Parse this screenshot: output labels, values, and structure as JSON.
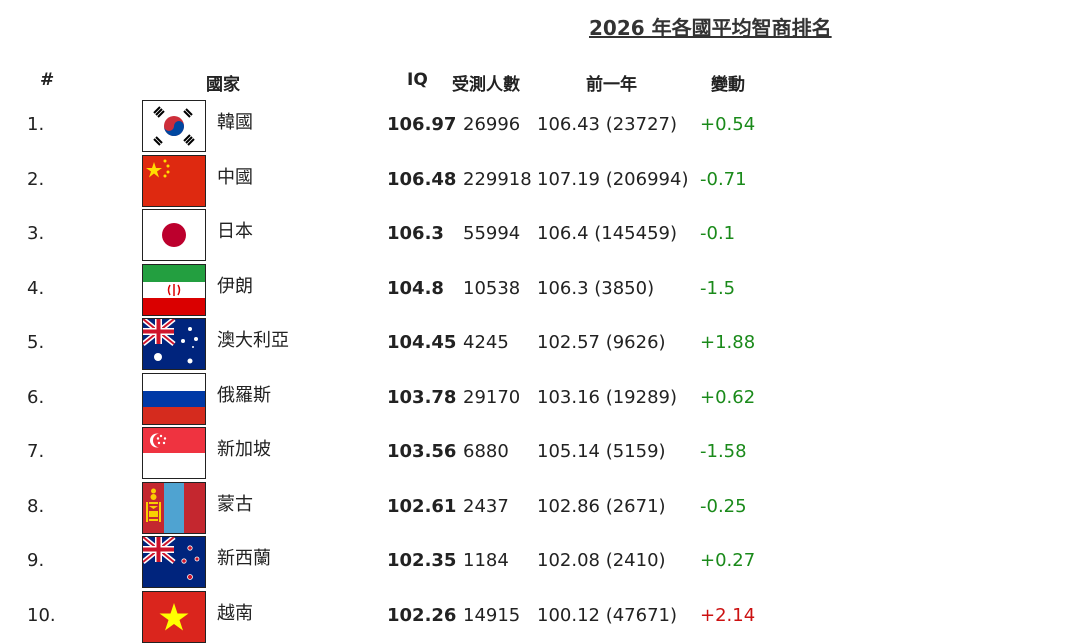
{
  "title": "2026 年各國平均智商排名",
  "headers": {
    "rank": "#",
    "country": "國家",
    "iq": "IQ",
    "tested": "受測人數",
    "previous": "前一年",
    "change": "變動"
  },
  "rows": [
    {
      "rank": "1.",
      "flag": "south-korea-flag",
      "country": "韓國",
      "iq": "106.97",
      "tested": "26996",
      "previous": "106.43 (23727)",
      "change": "+0.54",
      "change_color": "#1a8a1a"
    },
    {
      "rank": "2.",
      "flag": "china-flag",
      "country": "中國",
      "iq": "106.48",
      "tested": "229918",
      "previous": "107.19 (206994)",
      "change": "-0.71",
      "change_color": "#1a8a1a"
    },
    {
      "rank": "3.",
      "flag": "japan-flag",
      "country": "日本",
      "iq": "106.3",
      "tested": "55994",
      "previous": "106.4 (145459)",
      "change": "-0.1",
      "change_color": "#1a8a1a"
    },
    {
      "rank": "4.",
      "flag": "iran-flag",
      "country": "伊朗",
      "iq": "104.8",
      "tested": "10538",
      "previous": "106.3 (3850)",
      "change": "-1.5",
      "change_color": "#1a8a1a"
    },
    {
      "rank": "5.",
      "flag": "australia-flag",
      "country": "澳大利亞",
      "iq": "104.45",
      "tested": "4245",
      "previous": "102.57 (9626)",
      "change": "+1.88",
      "change_color": "#1a8a1a"
    },
    {
      "rank": "6.",
      "flag": "russia-flag",
      "country": "俄羅斯",
      "iq": "103.78",
      "tested": "29170",
      "previous": "103.16 (19289)",
      "change": "+0.62",
      "change_color": "#1a8a1a"
    },
    {
      "rank": "7.",
      "flag": "singapore-flag",
      "country": "新加坡",
      "iq": "103.56",
      "tested": "6880",
      "previous": "105.14 (5159)",
      "change": "-1.58",
      "change_color": "#1a8a1a"
    },
    {
      "rank": "8.",
      "flag": "mongolia-flag",
      "country": "蒙古",
      "iq": "102.61",
      "tested": "2437",
      "previous": "102.86 (2671)",
      "change": "-0.25",
      "change_color": "#1a8a1a"
    },
    {
      "rank": "9.",
      "flag": "new-zealand-flag",
      "country": "新西蘭",
      "iq": "102.35",
      "tested": "1184",
      "previous": "102.08 (2410)",
      "change": "+0.27",
      "change_color": "#1a8a1a"
    },
    {
      "rank": "10.",
      "flag": "vietnam-flag",
      "country": "越南",
      "iq": "102.26",
      "tested": "14915",
      "previous": "100.12 (47671)",
      "change": "+2.14",
      "change_color": "#cc1111"
    }
  ]
}
